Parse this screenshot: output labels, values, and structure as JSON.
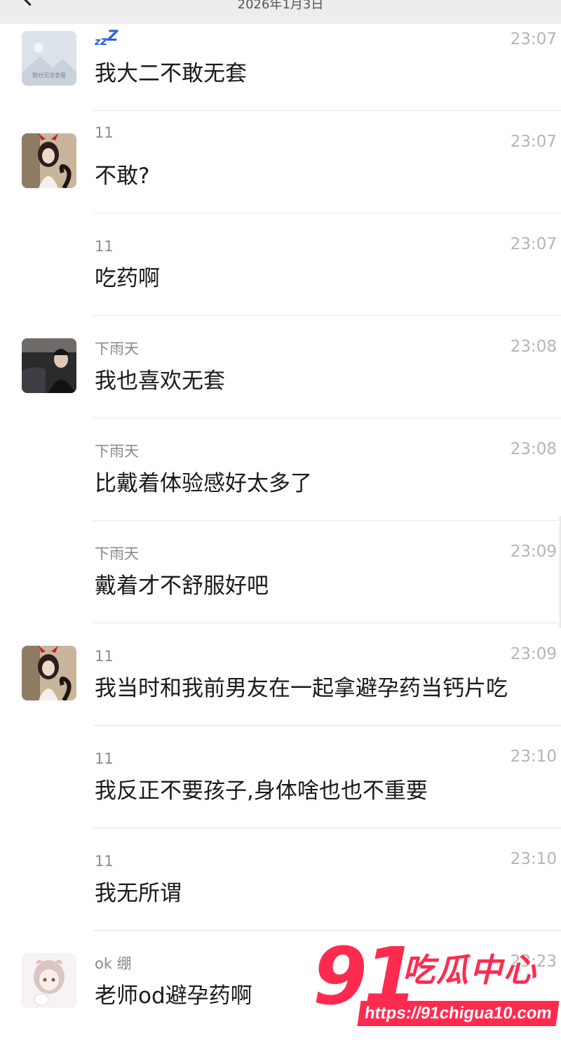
{
  "header": {
    "date": "2026年1月3日"
  },
  "messages": [
    {
      "avatar": "placeholder-image-avatar",
      "avatar_caption": "暂时无法查看",
      "sender": "zzz-icon",
      "time": "23:07",
      "text": "我大二不敢无套"
    },
    {
      "avatar": "girl-cat-ears-avatar",
      "sender": "11",
      "time": "23:07",
      "text": "不敢?"
    },
    {
      "avatar": "",
      "sender": "11",
      "time": "23:07",
      "text": "吃药啊"
    },
    {
      "avatar": "man-in-car-avatar",
      "sender": "下雨天",
      "time": "23:08",
      "text": "我也喜欢无套"
    },
    {
      "avatar": "",
      "sender": "下雨天",
      "time": "23:08",
      "text": "比戴着体验感好太多了"
    },
    {
      "avatar": "",
      "sender": "下雨天",
      "time": "23:09",
      "text": "戴着才不舒服好吧"
    },
    {
      "avatar": "girl-cat-ears-avatar",
      "sender": "11",
      "time": "23:09",
      "text": "我当时和我前男友在一起拿避孕药当钙片吃"
    },
    {
      "avatar": "",
      "sender": "11",
      "time": "23:10",
      "text": "我反正不要孩子,身体啥也也不重要"
    },
    {
      "avatar": "",
      "sender": "11",
      "time": "23:10",
      "text": "我无所谓"
    },
    {
      "avatar": "anime-girl-avatar",
      "sender": "ok 绷",
      "time": "23:23",
      "text": "老师od避孕药啊"
    }
  ],
  "watermark": {
    "logo": "91",
    "title": "吃瓜中心",
    "url": "https://91chigua10.com"
  },
  "colors": {
    "time": "#b5b5b5",
    "sender": "#8a8a8a",
    "text": "#1a1a1a",
    "watermark": "#ff2b4f"
  }
}
